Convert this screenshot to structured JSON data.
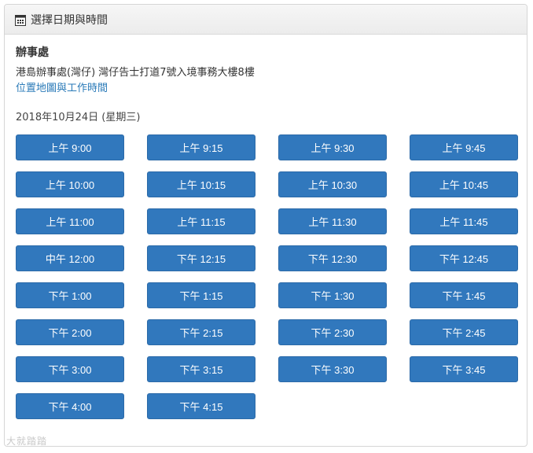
{
  "header": {
    "icon": "calendar-icon",
    "title": "選擇日期與時間"
  },
  "office": {
    "title": "辦事處",
    "address": "港島辦事處(灣仔) 灣仔告士打道7號入境事務大樓8樓",
    "link_label": "位置地圖與工作時間"
  },
  "date_label": "2018年10月24日 (星期三)",
  "slots": [
    "上午 9:00",
    "上午 9:15",
    "上午 9:30",
    "上午 9:45",
    "上午 10:00",
    "上午 10:15",
    "上午 10:30",
    "上午 10:45",
    "上午 11:00",
    "上午 11:15",
    "上午 11:30",
    "上午 11:45",
    "中午 12:00",
    "下午 12:15",
    "下午 12:30",
    "下午 12:45",
    "下午 1:00",
    "下午 1:15",
    "下午 1:30",
    "下午 1:45",
    "下午 2:00",
    "下午 2:15",
    "下午 2:30",
    "下午 2:45",
    "下午 3:00",
    "下午 3:15",
    "下午 3:30",
    "下午 3:45",
    "下午 4:00",
    "下午 4:15"
  ],
  "watermark": "大就踏踏",
  "colors": {
    "button": "#3178bd",
    "link": "#2a7ab8"
  }
}
